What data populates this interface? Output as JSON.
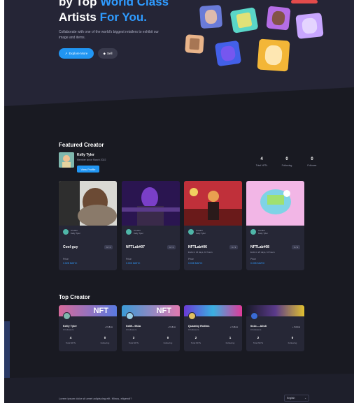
{
  "hero": {
    "title_line1": "by Top ",
    "title_line1_accent": "World Class",
    "title_line2": "Artists ",
    "title_line2_accent": "For You.",
    "description": "Collaborate with one of the world's biggest retailers to exhibit our image and items.",
    "explore_button": "Explore More",
    "sell_button": "Sell"
  },
  "featured": {
    "section_title": "Featured Creator",
    "creator_name": "Kelly Tyler",
    "member_since": "Member since March 2022",
    "view_profile_button": "View Profile",
    "stats": [
      {
        "value": "4",
        "label": "Total NFTs"
      },
      {
        "value": "0",
        "label": "Following"
      },
      {
        "value": "0",
        "label": "Follower"
      }
    ],
    "nfts": [
      {
        "owner_role": "Creator",
        "owner_name": "Kelly Tyler",
        "name": "Cool guy",
        "badge": "1 / 1",
        "sub": "",
        "price_label": "Price",
        "price": "0.028 MATIC"
      },
      {
        "owner_role": "Creator",
        "owner_name": "Kelly Tyler",
        "name": "NFTLab#07",
        "badge": "1 / 1",
        "sub": "",
        "price_label": "Price",
        "price": "0.005 MATIC"
      },
      {
        "owner_role": "Creator",
        "owner_name": "Kelly Tyler",
        "name": "NFTLab#06",
        "badge": "1 / 1",
        "sub": "Ends in 23 days, 10 hours",
        "price_label": "Price",
        "price": "0.008 MATIC"
      },
      {
        "owner_role": "Creator",
        "owner_name": "Kelly Tyler",
        "name": "NFTLab#08",
        "badge": "1 / 1",
        "sub": "Ends in 23 days, 10 hours",
        "price_label": "Price",
        "price": "0.005 MATIC"
      }
    ]
  },
  "top_creator": {
    "section_title": "Top Creator",
    "creators": [
      {
        "name": "Kelly Tyler",
        "followers": "0 Followers",
        "follow": "+ Follow",
        "nfts": "4",
        "nfts_label": "Total NFTs",
        "following": "0",
        "following_label": "Following",
        "banner": "NFT"
      },
      {
        "name": "0x89...961a",
        "followers": "0 Followers",
        "follow": "+ Follow",
        "nfts": "3",
        "nfts_label": "Total NFTs",
        "following": "0",
        "following_label": "Following",
        "banner": "NFT"
      },
      {
        "name": "Quamby Rollins",
        "followers": "0 Followers",
        "follow": "+ Follow",
        "nfts": "2",
        "nfts_label": "Total NFTs",
        "following": "1",
        "following_label": "Following",
        "banner": ""
      },
      {
        "name": "0x2c....A0c8",
        "followers": "0 Followers",
        "follow": "+ Follow",
        "nfts": "2",
        "nfts_label": "Total NFTs",
        "following": "0",
        "following_label": "Following",
        "banner": ""
      }
    ]
  },
  "footer": {
    "text": "Lorem ipsum dolor sit amet adipiscing elit. Minus, eligendi?",
    "language": "English"
  },
  "colors": {
    "accent": "#2196f3",
    "background": "#191a22",
    "card": "#262736"
  }
}
